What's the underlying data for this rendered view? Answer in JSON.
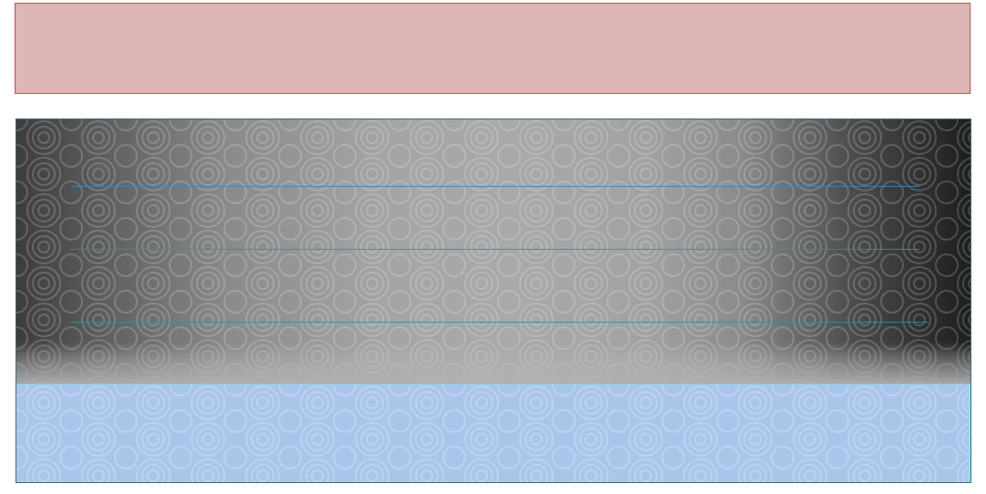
{
  "colors": {
    "top_panel_fill": "#deb6b6",
    "top_panel_border": "#d9484a",
    "main_panel_border": "#3a6e8a",
    "guide_line": "#3e86b5",
    "blue_band_fill": "#a9c6ea",
    "blue_band_edge": "#7fd3ee"
  },
  "decor": {
    "pattern": "spiral-swirl-pattern",
    "guide_line_count": 3
  }
}
